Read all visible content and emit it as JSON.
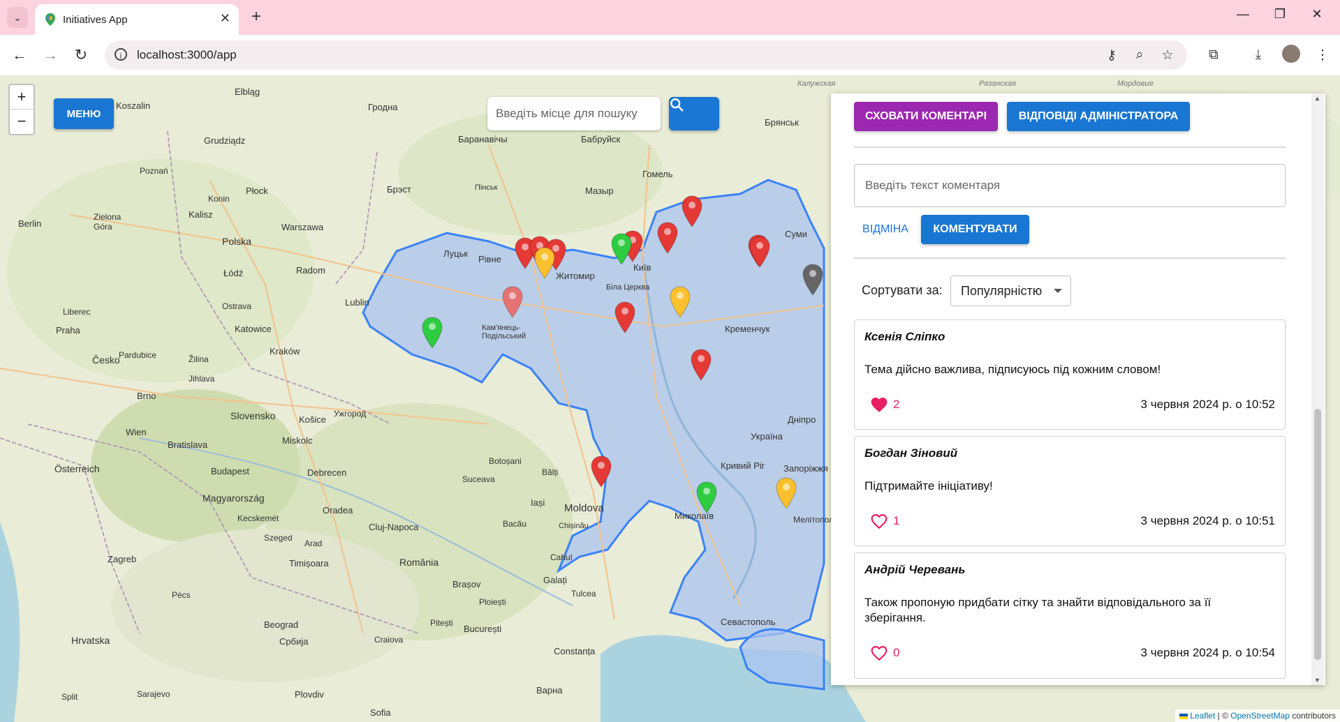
{
  "browser": {
    "tab_title": "Initiatives App",
    "url": "localhost:3000/app"
  },
  "map": {
    "menu_label": "МЕНЮ",
    "zoom_in": "+",
    "zoom_out": "−",
    "search_placeholder": "Введіть місце для пошуку",
    "attribution": {
      "leaflet": "Leaflet",
      "sep": " | © ",
      "osm": "OpenStreetMap",
      "suffix": " contributors"
    },
    "labels": [
      "Гродна",
      "Брянськ",
      "Баранавічы",
      "Бабруйск",
      "Гомель",
      "Брэст",
      "Мазыр",
      "Пінськ",
      "Луцьк",
      "Рівне",
      "Житомир",
      "Київ",
      "Біла Церква",
      "Суми",
      "Кам'янець-Подільський",
      "Кременчук",
      "Україна",
      "Дніпро",
      "Кривий Ріг",
      "Запоріжжя",
      "Миколаїв",
      "Мелітополь",
      "Севастополь",
      "Moldova",
      "Iași",
      "Chișinău",
      "Galați",
      "Constanța",
      "România",
      "București",
      "Brașov",
      "Cluj-Napoca",
      "Budapest",
      "Magyarország",
      "Slovensko",
      "Bratislava",
      "Wien",
      "Österreich",
      "Zagreb",
      "Hrvatska",
      "Beograd",
      "Србија",
      "Sofia",
      "Warszawa",
      "Polska",
      "Łódź",
      "Radom",
      "Lublin",
      "Kraków",
      "Katowice",
      "Praha",
      "Česko",
      "Berlin",
      "Brno",
      "Košice",
      "Miskolc",
      "Debrecen",
      "Oradea",
      "Timișoara",
      "Plovdiv",
      "Варна",
      "Рязанская",
      "Калужская",
      "Мордовия",
      "Ужгород",
      "Koszalin",
      "Elbląg",
      "Grudziądz",
      "Płock",
      "Kalisz",
      "Konin",
      "Zielona Góra",
      "Poznań",
      "Liberec",
      "Pardubice",
      "Jihlava",
      "Ostrava",
      "Žilina",
      "Szeged",
      "Arad",
      "Pécs",
      "Kecskemét",
      "Sarajevo",
      "Split",
      "Craiova",
      "Pitești",
      "Ploiești",
      "Bacău",
      "Suceava",
      "Botoșani",
      "Bălți",
      "Cahul",
      "Tulcea"
    ],
    "markers": [
      "red",
      "red",
      "red",
      "yellow",
      "red",
      "green",
      "red",
      "red",
      "red",
      "pink",
      "yellow",
      "red",
      "red",
      "green",
      "red",
      "green",
      "gray",
      "yellow",
      "red"
    ]
  },
  "panel": {
    "hide_comments_label": "СХОВАТИ КОМЕНТАРІ",
    "admin_replies_label": "ВІДПОВІДІ АДМІНІСТРАТОРА",
    "comment_placeholder": "Введіть текст коментаря",
    "cancel_label": "ВІДМІНА",
    "comment_label": "КОМЕНТУВАТИ",
    "sort_label": "Сортувати за:",
    "sort_value": "Популярністю",
    "comments": [
      {
        "author": "Ксенія Сліпко",
        "text": "Тема дійсно важлива, підписуюсь під кожним словом!",
        "likes": "2",
        "liked": true,
        "date": "3 червня 2024 р. о 10:52"
      },
      {
        "author": "Богдан Зіновий",
        "text": "Підтримайте ініціативу!",
        "likes": "1",
        "liked": false,
        "date": "3 червня 2024 р. о 10:51"
      },
      {
        "author": "Андрій Черевань",
        "text": "Також пропоную придбати сітку та знайти відповідального за її зберігання.",
        "likes": "0",
        "liked": false,
        "date": "3 червня 2024 р. о 10:54"
      }
    ]
  },
  "colors": {
    "primary": "#1976d2",
    "purple": "#9c27b0",
    "heart": "#e91e63",
    "ukraine_fill": "#aac4ef",
    "ukraine_border": "#3b82f6"
  }
}
